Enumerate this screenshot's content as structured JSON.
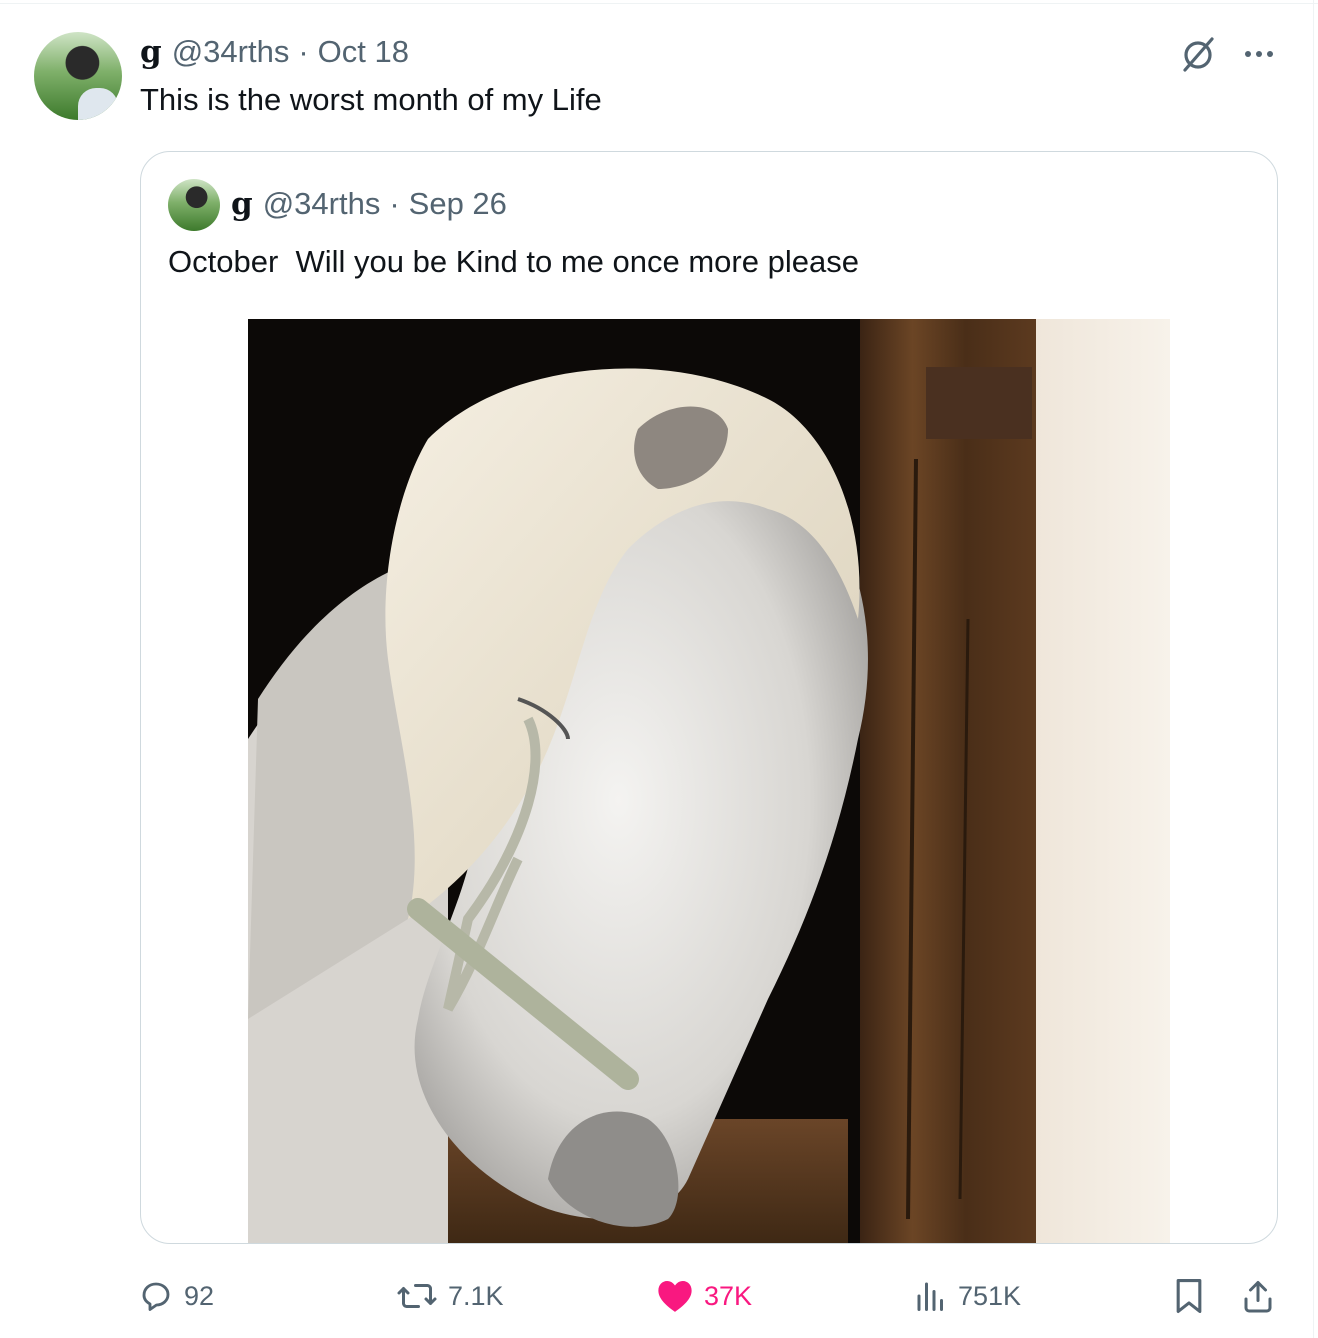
{
  "tweet": {
    "author_name": "g",
    "author_handle": "@34rths",
    "separator": "·",
    "date": "Oct 18",
    "text": "This is the worst month of my Life"
  },
  "quoted_tweet": {
    "author_name": "g",
    "author_handle": "@34rths",
    "separator": "·",
    "date": "Sep 26",
    "text": "October  Will you be Kind to me once more please",
    "image_description": "white-horse-leaning-on-stable-door"
  },
  "actions": {
    "replies": "92",
    "reposts": "7.1K",
    "likes": "37K",
    "views": "751K"
  },
  "icons": {
    "grok": "grok-icon",
    "more": "more-icon",
    "reply": "reply-icon",
    "repost": "repost-icon",
    "like": "heart-icon",
    "views": "views-icon",
    "bookmark": "bookmark-icon",
    "share": "share-icon"
  },
  "colors": {
    "text": "#0f1419",
    "secondary": "#536471",
    "like": "#f91880",
    "border": "#cfd9de"
  }
}
